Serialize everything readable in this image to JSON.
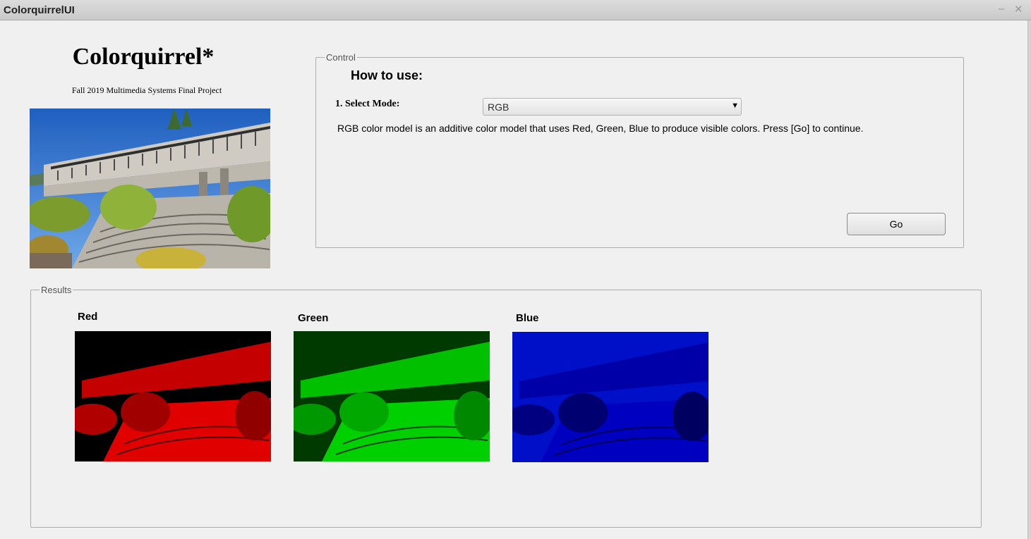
{
  "window": {
    "title": "ColorquirrelUI",
    "minimize_glyph": "–",
    "close_glyph": "✕"
  },
  "header": {
    "app_title": "Colorquirrel*",
    "subtitle": "Fall 2019 Multimedia Systems Final Project",
    "photo_icon": "building-photo"
  },
  "control": {
    "legend": "Control",
    "how_to": "How to use:",
    "mode_label": "1. Select Mode:",
    "mode_value": "RGB",
    "description": "RGB color model is an additive color model that uses Red, Green, Blue to produce visible colors. Press [Go] to continue.",
    "go_label": "Go"
  },
  "results": {
    "legend": "Results",
    "channels": [
      {
        "label": "Red",
        "color": "#e00000"
      },
      {
        "label": "Green",
        "color": "#00d000"
      },
      {
        "label": "Blue",
        "color": "#0000e0"
      }
    ]
  }
}
